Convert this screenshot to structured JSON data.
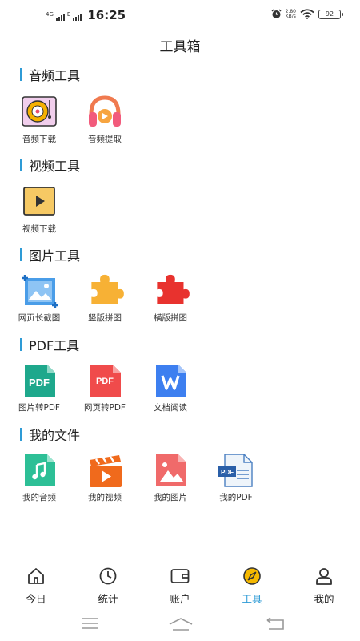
{
  "status_bar": {
    "network_left": "4G",
    "network_right": "E",
    "time": "16:25",
    "speed_value": "2.80",
    "speed_unit": "KB/s",
    "battery": "92"
  },
  "header": {
    "title": "工具箱"
  },
  "sections": {
    "audio": {
      "title": "音频工具",
      "tools": [
        {
          "label": "音频下载",
          "icon": "audio-download-icon"
        },
        {
          "label": "音频提取",
          "icon": "audio-extract-icon"
        }
      ]
    },
    "video": {
      "title": "视频工具",
      "tools": [
        {
          "label": "视频下载",
          "icon": "video-download-icon"
        }
      ]
    },
    "image": {
      "title": "图片工具",
      "tools": [
        {
          "label": "网页长截图",
          "icon": "long-screenshot-icon"
        },
        {
          "label": "竖版拼图",
          "icon": "vertical-puzzle-icon"
        },
        {
          "label": "横版拼图",
          "icon": "horizontal-puzzle-icon"
        }
      ]
    },
    "pdf": {
      "title": "PDF工具",
      "tools": [
        {
          "label": "图片转PDF",
          "icon": "image-to-pdf-icon",
          "badge": "PDF"
        },
        {
          "label": "网页转PDF",
          "icon": "webpage-to-pdf-icon",
          "badge": "PDF"
        },
        {
          "label": "文档阅读",
          "icon": "document-read-icon"
        }
      ]
    },
    "files": {
      "title": "我的文件",
      "tools": [
        {
          "label": "我的音频",
          "icon": "my-audio-icon"
        },
        {
          "label": "我的视频",
          "icon": "my-video-icon"
        },
        {
          "label": "我的图片",
          "icon": "my-image-icon"
        },
        {
          "label": "我的PDF",
          "icon": "my-pdf-icon",
          "badge": "PDF"
        }
      ]
    }
  },
  "bottom_nav": {
    "items": [
      {
        "label": "今日",
        "icon": "home-icon"
      },
      {
        "label": "统计",
        "icon": "clock-icon"
      },
      {
        "label": "账户",
        "icon": "wallet-icon"
      },
      {
        "label": "工具",
        "icon": "compass-icon",
        "active": true
      },
      {
        "label": "我的",
        "icon": "user-icon"
      }
    ]
  },
  "colors": {
    "accent": "#2e9bd6",
    "active_icon": "#f5b800"
  }
}
